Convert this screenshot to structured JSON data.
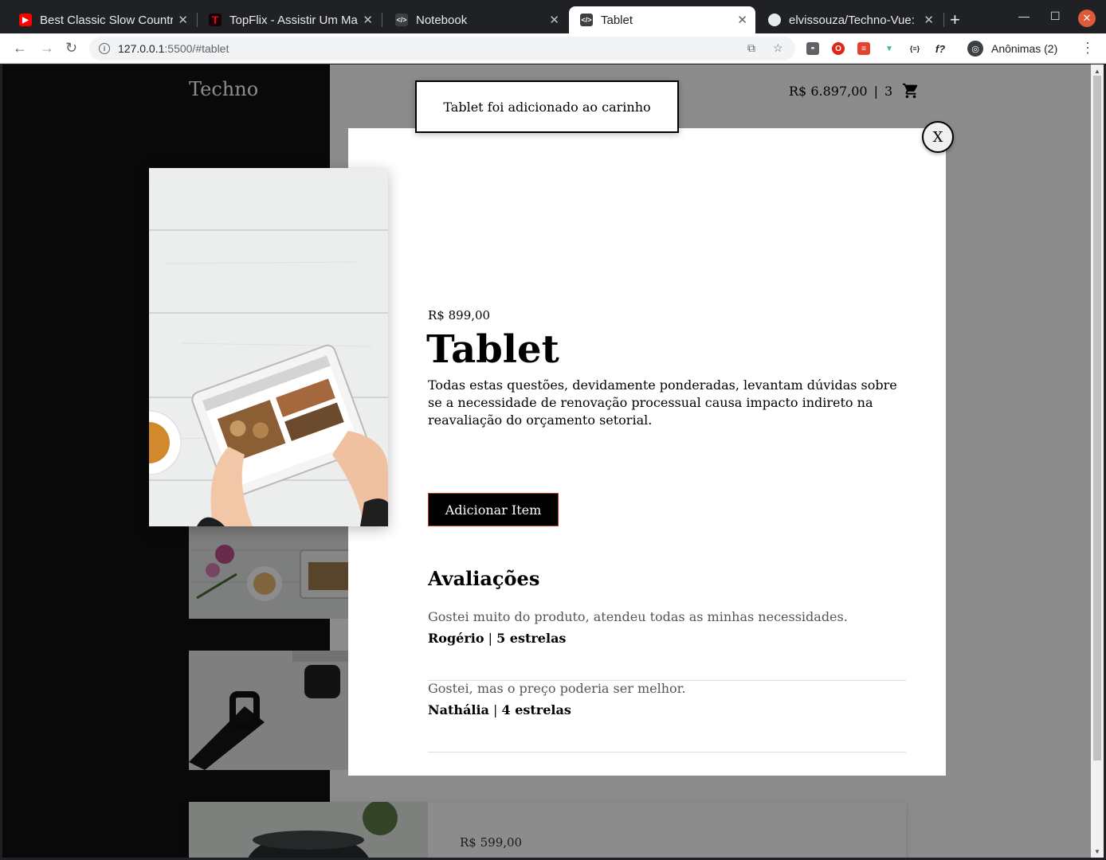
{
  "browser": {
    "tabs": [
      {
        "title": "Best Classic Slow Country",
        "favicon": "youtube-icon"
      },
      {
        "title": "TopFlix - Assistir Um Mal",
        "favicon": "topflix-icon"
      },
      {
        "title": "Notebook",
        "favicon": "code-icon"
      },
      {
        "title": "Tablet",
        "favicon": "code-icon",
        "active": true
      },
      {
        "title": "elvissouza/Techno-Vue: ",
        "favicon": "github-icon"
      }
    ],
    "url_host": "127.0.0.1",
    "url_path": ":5500/#tablet",
    "profile_label": "Anônimas (2)"
  },
  "site": {
    "logo": "Techno",
    "cart_total": "R$ 6.897,00",
    "cart_separator": "|",
    "cart_count": "3"
  },
  "toast": {
    "message": "Tablet foi adicionado ao carinho"
  },
  "modal": {
    "close_label": "X",
    "price": "R$ 899,00",
    "title": "Tablet",
    "description": "Todas estas questões, devidamente ponderadas, levantam dúvidas sobre se a necessidade de renovação processual causa impacto indireto na reavaliação do orçamento setorial.",
    "add_button": "Adicionar Item",
    "reviews_title": "Avaliações",
    "reviews": [
      {
        "text": "Gostei muito do produto, atendeu todas as minhas necessidades.",
        "name": "Rogério",
        "separator": "|",
        "stars": "5 estrelas"
      },
      {
        "text": "Gostei, mas o preço poderia ser melhor.",
        "name": "Nathália",
        "separator": "|",
        "stars": "4 estrelas"
      }
    ]
  },
  "background": {
    "next_product_price": "R$ 599,00"
  }
}
